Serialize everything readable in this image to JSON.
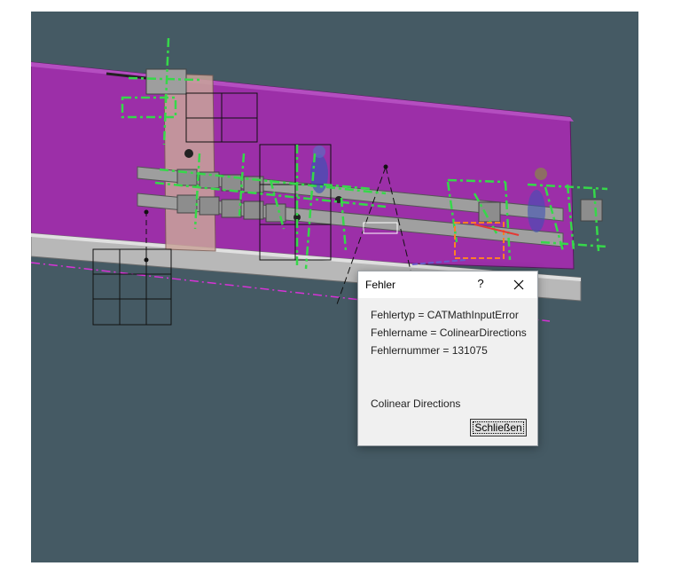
{
  "dialog": {
    "title": "Fehler",
    "help_glyph": "?",
    "close_icon": "close-icon",
    "lines": [
      "Fehlertyp = CATMathInputError",
      "Fehlername = ColinearDirections",
      "Fehlernummer = 131075"
    ],
    "message": "Colinear Directions",
    "button_label": "Schließen"
  },
  "scene": {
    "background_color": "#455a64",
    "panel_color": "#9c2fa8",
    "rail_color": "#bdbdbd",
    "guide_color": "#36d84a",
    "axis_color": "#d633d6"
  }
}
